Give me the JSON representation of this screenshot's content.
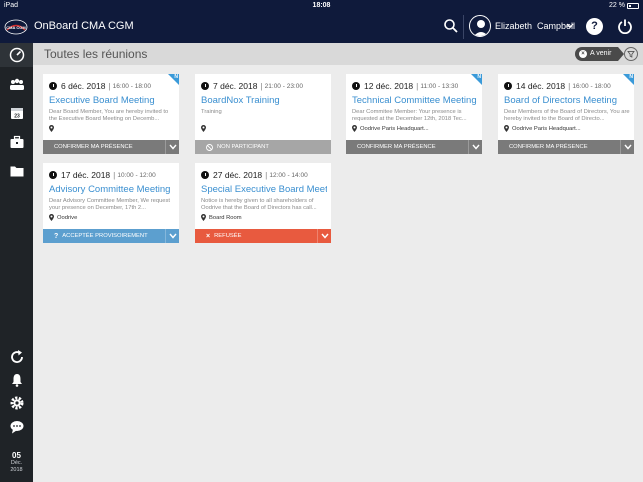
{
  "statusbar": {
    "device": "iPad",
    "time": "18:08",
    "battery": "22 %"
  },
  "app": {
    "title": "OnBoard CMA CGM",
    "logo_text": "CMA CGM"
  },
  "user": {
    "first_name": "Elizabeth",
    "last_name": "Campbell",
    "display": "Elizabeth  Campbell"
  },
  "help_label": "?",
  "page": {
    "title": "Toutes les réunions",
    "filter_label": "A venir"
  },
  "sidebar": {
    "items": [
      {
        "name": "dashboard-icon",
        "active": true
      },
      {
        "name": "people-icon"
      },
      {
        "name": "calendar-icon"
      },
      {
        "name": "briefcase-icon"
      },
      {
        "name": "folder-icon"
      }
    ],
    "bottom": [
      {
        "name": "sync-icon"
      },
      {
        "name": "bell-icon"
      },
      {
        "name": "settings-icon"
      },
      {
        "name": "chat-icon"
      }
    ],
    "date": {
      "day": "05",
      "month": "Déc.",
      "year": "2018"
    }
  },
  "meetings": [
    {
      "date": "6 déc. 2018",
      "time": "16:00 - 18:00",
      "title": "Executive Board Meeting",
      "desc": "Dear Board Member,  You are hereby invited to the Executive Board Meeting on Decemb...",
      "location": "",
      "action": "CONFIRMER MA PRÉSENCE",
      "new": true
    },
    {
      "date": "7 déc. 2018",
      "time": "21:00 - 23:00",
      "title": "BoardNox Training",
      "desc": "Training",
      "location": "",
      "action": "NON PARTICIPANT",
      "new": false
    },
    {
      "date": "12 déc. 2018",
      "time": "11:00 - 13:30",
      "title": "Technical Committee Meeting",
      "desc": "Dear Commitee Member:  Your presence is requested at the December 12th, 2018 Tec...",
      "location": "Oodrive Paris Headquart...",
      "action": "CONFIRMER MA PRÉSENCE",
      "new": true
    },
    {
      "date": "14 déc. 2018",
      "time": "16:00 - 18:00",
      "title": "Board of Directors Meeting",
      "desc": "Dear Members of the Board of Directors,  You are hereby invited to the Board of Directo...",
      "location": "Oodrive Paris Headquart...",
      "action": "CONFIRMER MA PRÉSENCE",
      "new": true
    },
    {
      "date": "17 déc. 2018",
      "time": "10:00 - 12:00",
      "title": "Advisory Committee Meeting",
      "desc": "Dear Advisory Committee Member,  We request your presence on December, 17th 2...",
      "location": "Oodrive",
      "action": "ACCEPTÉE PROVISOIREMENT",
      "new": false
    },
    {
      "date": "27 déc. 2018",
      "time": "12:00 - 14:00",
      "title": "Special Executive Board Meeting",
      "desc": "Notice is hereby given to all shareholders of Oodrive that the Board of Directors has call...",
      "location": "Board Room",
      "action": "REFUSÉE",
      "new": false
    }
  ],
  "colors": {
    "topbar": "#0f1a3b",
    "sidebar": "#1f2327",
    "link": "#3a8fd0",
    "accept_tentative": "#5c9fcf",
    "refused": "#e85a3f",
    "confirm": "#7a7a7a",
    "non_participant": "#a6a6a6"
  }
}
